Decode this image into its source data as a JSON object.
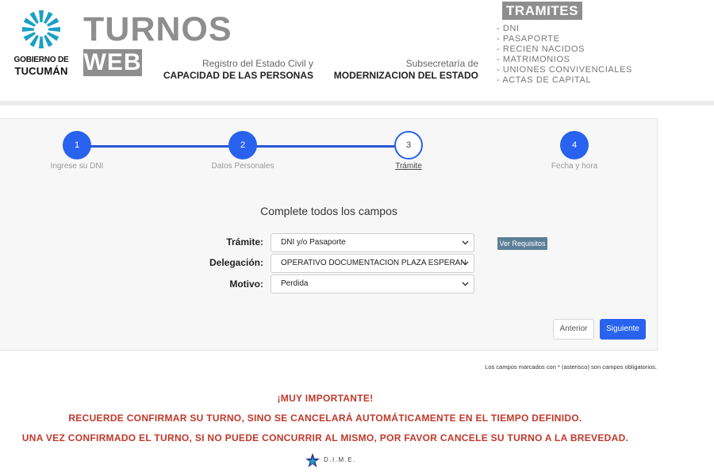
{
  "header": {
    "logo_line1": "GOBIERNO DE",
    "logo_line2": "TUCUMÁN",
    "title_big": "TURNOS",
    "title_web": "WEB",
    "registry_line1": "Registro del Estado Civil y",
    "registry_line2": "CAPACIDAD DE LAS PERSONAS",
    "subsecretaria_line1": "Subsecretaría de",
    "subsecretaria_line2": "MODERNIZACION DEL ESTADO",
    "tramites_title": "TRAMITES",
    "tramites_list": [
      "- DNI",
      "- PASAPORTE",
      "- RECIEN NACIDOS",
      "- MATRIMONIOS",
      "- UNIONES CONVIVENCIALES",
      "- ACTAS DE CAPITAL"
    ]
  },
  "steps": [
    {
      "number": "1",
      "label": "Ingrese su DNI",
      "state": "done"
    },
    {
      "number": "2",
      "label": "Datos Personales",
      "state": "done"
    },
    {
      "number": "3",
      "label": "Trámite",
      "state": "current"
    },
    {
      "number": "4",
      "label": "Fecha y hora",
      "state": "pending"
    }
  ],
  "form": {
    "title": "Complete todos los campos",
    "tramite_label": "Trámite:",
    "tramite_value": "DNI y/o Pasaporte",
    "delegacion_label": "Delegación:",
    "delegacion_value": "OPERATIVO DOCUMENTACION PLAZA ESPERAN",
    "motivo_label": "Motivo:",
    "motivo_value": "Perdida",
    "requisitos_button": "Ver Requisitos",
    "prev_button": "Anterior",
    "next_button": "Siguiente"
  },
  "notes": {
    "asterisk": "Los campos marcados con * (asterisco) son campos obligatorios.",
    "warning_title": "¡MUY IMPORTANTE!",
    "warning_line1": "RECUERDE CONFIRMAR SU TURNO, SINO SE CANCELARÁ AUTOMÁTICAMENTE EN EL TIEMPO DEFINIDO.",
    "warning_line2": "UNA VEZ CONFIRMADO EL TURNO, SI NO PUEDE CONCURRIR AL MISMO, POR FAVOR CANCELE SU TURNO A LA BREVEDAD."
  },
  "footer": {
    "brand": "DIME"
  },
  "colors": {
    "accent_blue": "#2862ee",
    "header_gray": "#8e8e8e",
    "warning_red": "#c0392b",
    "requisitos_button": "#5d7f97",
    "logo_teal": "#1aa0c4"
  },
  "icons": {
    "logo": "tucuman-sun-logo-icon",
    "select_chevron": "chevron-down-icon",
    "dime": "dime-star-icon"
  }
}
